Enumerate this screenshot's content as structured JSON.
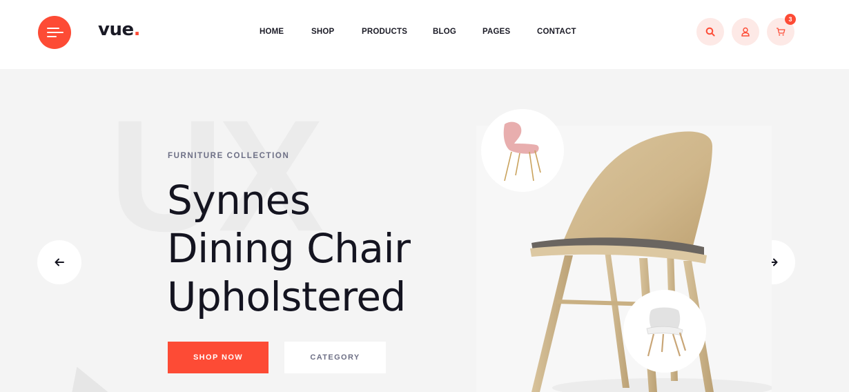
{
  "header": {
    "menu_icon": "hamburger-icon",
    "logo": {
      "text": "vue",
      "accent": "."
    },
    "nav": [
      {
        "label": "HOME"
      },
      {
        "label": "SHOP"
      },
      {
        "label": "PRODUCTS"
      },
      {
        "label": "BLOG"
      },
      {
        "label": "PAGES"
      },
      {
        "label": "CONTACT"
      }
    ],
    "actions": {
      "search_icon": "search-icon",
      "user_icon": "user-icon",
      "cart_icon": "cart-icon",
      "cart_count": "3"
    }
  },
  "hero": {
    "background_text": "UX",
    "eyebrow": "FURNITURE COLLECTION",
    "title_lines": [
      "Synnes",
      "Dining Chair",
      "Upholstered"
    ],
    "primary_button": "SHOP NOW",
    "secondary_button": "CATEGORY",
    "prev_icon": "arrow-left-icon",
    "next_icon": "arrow-right-icon"
  },
  "colors": {
    "accent": "#fd4b35",
    "accent_soft": "#fde9e6",
    "text_dark": "#141420",
    "text_muted": "#6d6f85",
    "hero_bg": "#f4f4f4"
  }
}
